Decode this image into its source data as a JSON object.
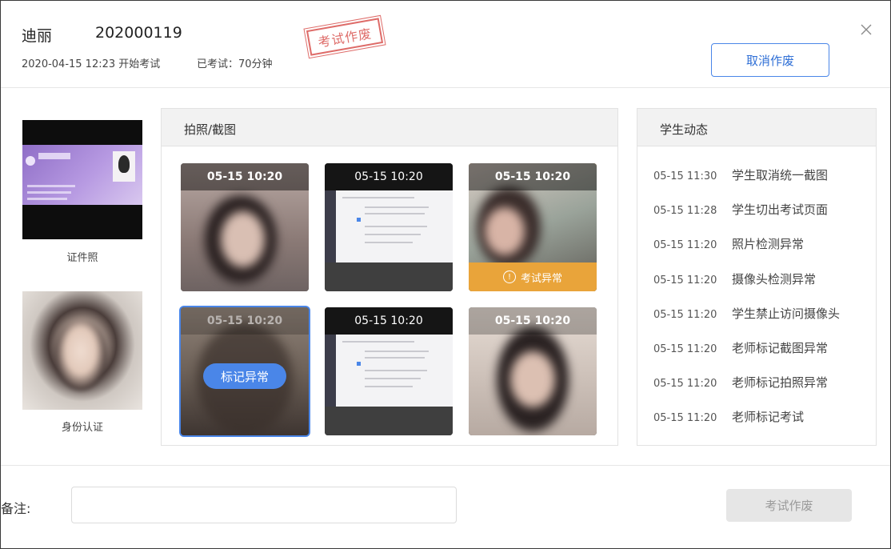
{
  "header": {
    "student_name": "迪丽",
    "student_id": "202000119",
    "exam_start": "2020-04-15 12:23 开始考试",
    "exam_elapsed": "已考试：70分钟",
    "stamp": "考试作废",
    "cancel_void_label": "取消作废"
  },
  "left": {
    "id_photo_label": "证件照",
    "identity_label": "身份认证"
  },
  "photos": {
    "title": "拍照/截图",
    "tiles": [
      {
        "time": "05-15 10:20",
        "kind": "camera"
      },
      {
        "time": "05-15  10:20",
        "kind": "screenshot"
      },
      {
        "time": "05-15 10:20",
        "kind": "camera",
        "warning": "考试异常"
      },
      {
        "time": "05-15 10:20",
        "kind": "camera",
        "badge": "标记异常"
      },
      {
        "time": "05-15  10:20",
        "kind": "screenshot"
      },
      {
        "time": "05-15 10:20",
        "kind": "camera"
      }
    ]
  },
  "events": {
    "title": "学生动态",
    "items": [
      {
        "time": "05-15 11:30",
        "text": "学生取消统一截图"
      },
      {
        "time": "05-15 11:28",
        "text": "学生切出考试页面"
      },
      {
        "time": "05-15 11:20",
        "text": "照片检测异常"
      },
      {
        "time": "05-15 11:20",
        "text": "摄像头检测异常"
      },
      {
        "time": "05-15 11:20",
        "text": "学生禁止访问摄像头"
      },
      {
        "time": "05-15 11:20",
        "text": "老师标记截图异常"
      },
      {
        "time": "05-15 11:20",
        "text": "老师标记拍照异常"
      },
      {
        "time": "05-15 11:20",
        "text": "老师标记考试"
      }
    ]
  },
  "footer": {
    "remark_label": "备注:",
    "remark_value": "",
    "submit_label": "考试作废"
  },
  "icons": {
    "close": "close-icon",
    "warning": "warning-circle-icon"
  },
  "colors": {
    "accent": "#4a86e8",
    "warning": "#e9a43a",
    "stamp": "#d9534f"
  }
}
